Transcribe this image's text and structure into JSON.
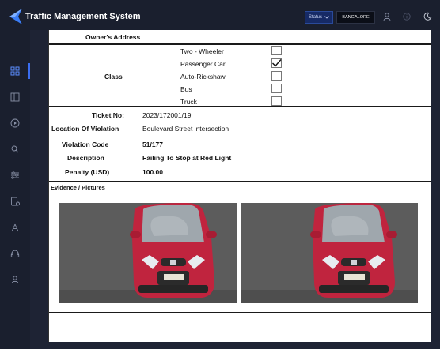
{
  "app": {
    "title": "Traffic Management System"
  },
  "header": {
    "status_label": "Status",
    "city_label": "BANGALORE",
    "icons": [
      "user-icon",
      "info-icon",
      "moon-icon"
    ]
  },
  "sidebar": {
    "items": [
      "dashboard-icon",
      "split-icon",
      "play-icon",
      "search-icon",
      "sliders-icon",
      "vehicle-icon",
      "antenna-icon",
      "headset-icon",
      "person-icon"
    ],
    "active": "dashboard-icon"
  },
  "document": {
    "owner_address_label": "Owner's Address",
    "class_label": "Class",
    "class_options": [
      {
        "label": "Two - Wheeler",
        "checked": false
      },
      {
        "label": "Passenger Car",
        "checked": true
      },
      {
        "label": "Auto-Rickshaw",
        "checked": false
      },
      {
        "label": "Bus",
        "checked": false
      },
      {
        "label": "Truck",
        "checked": false
      }
    ],
    "fields": [
      {
        "label": "Ticket No:",
        "value": "2023/172001/19",
        "bold": false
      },
      {
        "label": "Location Of Violation",
        "value": "Boulevard Street intersection",
        "bold": false
      },
      {
        "label": "Violation Code",
        "value": "51/177",
        "bold": true
      },
      {
        "label": "Description",
        "value": "Failing To Stop at Red Light",
        "bold": true
      },
      {
        "label": "Penalty (USD)",
        "value": "100.00",
        "bold": true
      }
    ],
    "evidence_label": "Evidence / Pictures",
    "evidence_images": [
      "car-photo-1",
      "car-photo-2"
    ]
  },
  "colors": {
    "background": "#1e2334",
    "panel": "#1a1f2e",
    "accent": "#3a6df0",
    "status_button": "#162a66",
    "car_body": "#c0243e"
  }
}
